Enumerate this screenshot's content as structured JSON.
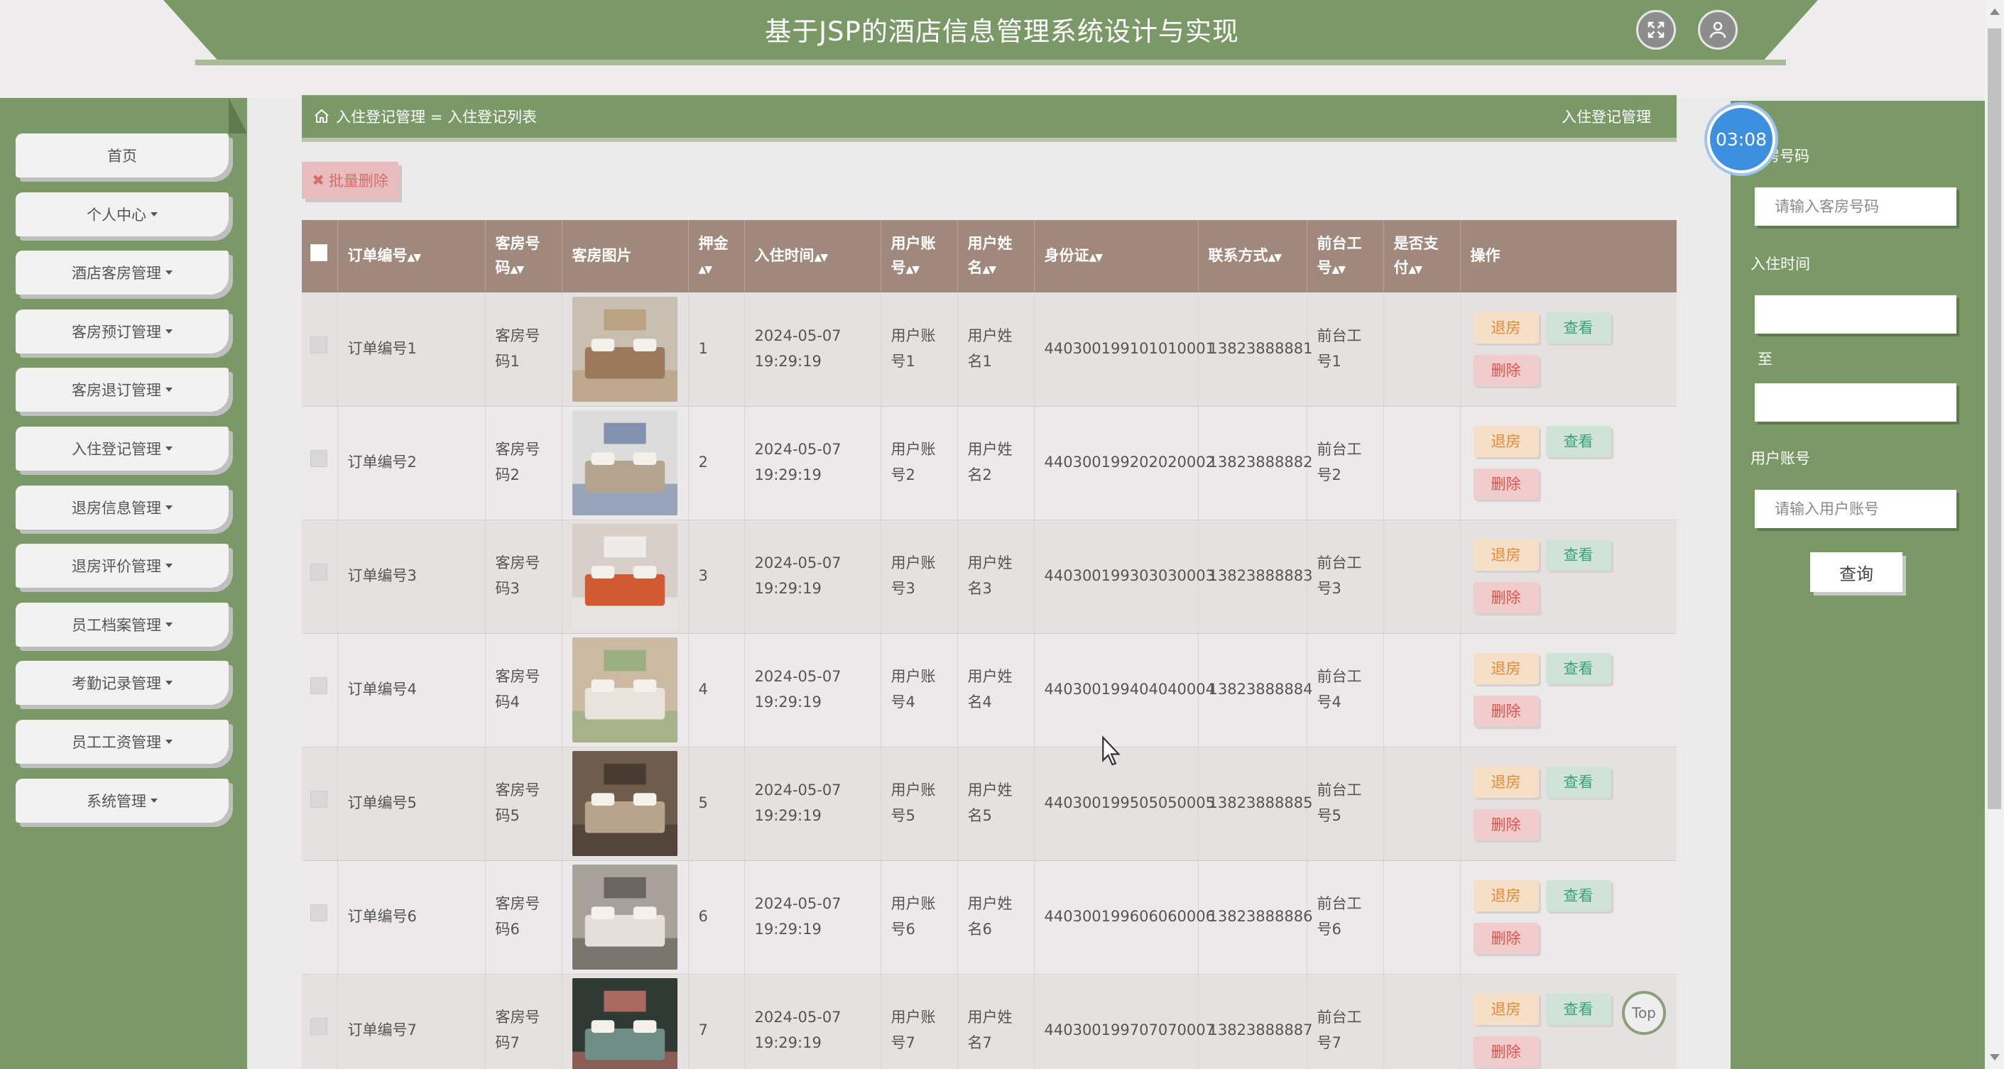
{
  "header": {
    "title": "基于JSP的酒店信息管理系统设计与实现",
    "fullscreen_icon": "fullscreen-icon",
    "user_icon": "user-icon"
  },
  "sidebar": {
    "items": [
      {
        "label": "首页",
        "has_caret": false
      },
      {
        "label": "个人中心",
        "has_caret": true
      },
      {
        "label": "酒店客房管理",
        "has_caret": true
      },
      {
        "label": "客房预订管理",
        "has_caret": true
      },
      {
        "label": "客房退订管理",
        "has_caret": true
      },
      {
        "label": "入住登记管理",
        "has_caret": true
      },
      {
        "label": "退房信息管理",
        "has_caret": true
      },
      {
        "label": "退房评价管理",
        "has_caret": true
      },
      {
        "label": "员工档案管理",
        "has_caret": true
      },
      {
        "label": "考勤记录管理",
        "has_caret": true
      },
      {
        "label": "员工工资管理",
        "has_caret": true
      },
      {
        "label": "系统管理",
        "has_caret": true
      }
    ]
  },
  "breadcrumb": {
    "path": "入住登记管理 = 入住登记列表",
    "right_title": "入住登记管理"
  },
  "toolbar": {
    "batch_delete_label": "批量删除"
  },
  "table": {
    "headers": {
      "order_no": "订单编号",
      "room_no": "客房号码",
      "room_img": "客房图片",
      "deposit": "押金",
      "checkin_time": "入住时间",
      "user_account": "用户账号",
      "user_name": "用户姓名",
      "id_card": "身份证",
      "phone": "联系方式",
      "staff_no": "前台工号",
      "paid": "是否支付",
      "actions": "操作"
    },
    "actions": {
      "checkout": "退房",
      "view": "查看",
      "delete": "删除"
    },
    "rows": [
      {
        "order_no": "订单编号1",
        "room_no": "客房号码1",
        "deposit": "1",
        "checkin_time": "2024-05-07 19:29:19",
        "user_account": "用户账号1",
        "user_name": "用户姓名1",
        "id_card": "440300199101010001",
        "phone": "13823888881",
        "staff_no": "前台工号1",
        "paid": ""
      },
      {
        "order_no": "订单编号2",
        "room_no": "客房号码2",
        "deposit": "2",
        "checkin_time": "2024-05-07 19:29:19",
        "user_account": "用户账号2",
        "user_name": "用户姓名2",
        "id_card": "440300199202020002",
        "phone": "13823888882",
        "staff_no": "前台工号2",
        "paid": ""
      },
      {
        "order_no": "订单编号3",
        "room_no": "客房号码3",
        "deposit": "3",
        "checkin_time": "2024-05-07 19:29:19",
        "user_account": "用户账号3",
        "user_name": "用户姓名3",
        "id_card": "440300199303030003",
        "phone": "13823888883",
        "staff_no": "前台工号3",
        "paid": ""
      },
      {
        "order_no": "订单编号4",
        "room_no": "客房号码4",
        "deposit": "4",
        "checkin_time": "2024-05-07 19:29:19",
        "user_account": "用户账号4",
        "user_name": "用户姓名4",
        "id_card": "440300199404040004",
        "phone": "13823888884",
        "staff_no": "前台工号4",
        "paid": ""
      },
      {
        "order_no": "订单编号5",
        "room_no": "客房号码5",
        "deposit": "5",
        "checkin_time": "2024-05-07 19:29:19",
        "user_account": "用户账号5",
        "user_name": "用户姓名5",
        "id_card": "440300199505050005",
        "phone": "13823888885",
        "staff_no": "前台工号5",
        "paid": ""
      },
      {
        "order_no": "订单编号6",
        "room_no": "客房号码6",
        "deposit": "6",
        "checkin_time": "2024-05-07 19:29:19",
        "user_account": "用户账号6",
        "user_name": "用户姓名6",
        "id_card": "440300199606060006",
        "phone": "13823888886",
        "staff_no": "前台工号6",
        "paid": ""
      },
      {
        "order_no": "订单编号7",
        "room_no": "客房号码7",
        "deposit": "7",
        "checkin_time": "2024-05-07 19:29:19",
        "user_account": "用户账号7",
        "user_name": "用户姓名7",
        "id_card": "440300199707070007",
        "phone": "13823888887",
        "staff_no": "前台工号7",
        "paid": ""
      }
    ]
  },
  "search_panel": {
    "room_no_label": "房号码",
    "room_no_placeholder": "请输入客房号码",
    "checkin_label": "入住时间",
    "to_label": "至",
    "account_label": "用户账号",
    "account_placeholder": "请输入用户账号",
    "search_label": "查询"
  },
  "timer": {
    "value": "03:08"
  },
  "back_to_top": {
    "label": "Top"
  },
  "colors": {
    "primary_green": "#7a9966",
    "table_header": "#a0887c",
    "checkout": "#e08a3e",
    "view": "#3aa27a",
    "delete": "#d9534f",
    "timer_blue": "#3d8fe0"
  }
}
